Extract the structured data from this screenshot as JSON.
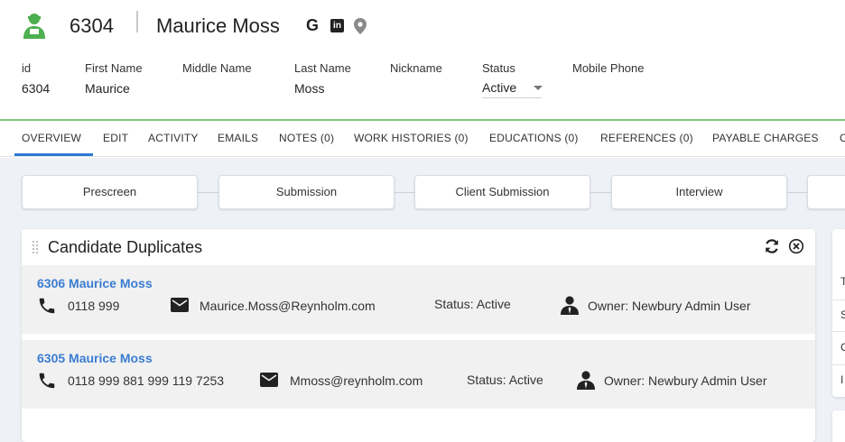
{
  "header": {
    "record_id": "6304",
    "name": "Maurice Moss",
    "google_label": "G",
    "linkedin_label": "in",
    "fields": [
      {
        "label": "id",
        "value": "6304"
      },
      {
        "label": "First Name",
        "value": "Maurice"
      },
      {
        "label": "Middle Name",
        "value": ""
      },
      {
        "label": "Last Name",
        "value": "Moss"
      },
      {
        "label": "Nickname",
        "value": ""
      },
      {
        "label": "Status",
        "value": "Active"
      },
      {
        "label": "Mobile Phone",
        "value": ""
      }
    ],
    "accent_color": "#4caf50"
  },
  "tabs": [
    {
      "label": "OVERVIEW",
      "active": true
    },
    {
      "label": "EDIT"
    },
    {
      "label": "ACTIVITY"
    },
    {
      "label": "EMAILS"
    },
    {
      "label": "NOTES (0)"
    },
    {
      "label": "WORK HISTORIES (0)"
    },
    {
      "label": "EDUCATIONS (0)"
    },
    {
      "label": "REFERENCES (0)"
    },
    {
      "label": "PAYABLE CHARGES"
    },
    {
      "label": "C"
    }
  ],
  "pipeline": [
    {
      "label": "Prescreen"
    },
    {
      "label": "Submission"
    },
    {
      "label": "Client Submission"
    },
    {
      "label": "Interview"
    }
  ],
  "duplicates_card": {
    "title": "Candidate Duplicates",
    "rows": [
      {
        "name": "6306 Maurice Moss",
        "phone": "0118 999",
        "email": "Maurice.Moss@Reynholm.com",
        "status": "Status: Active",
        "owner": "Owner: Newbury Admin User"
      },
      {
        "name": "6305 Maurice Moss",
        "phone": "0118 999 881 999 119 7253",
        "email": "Mmoss@reynholm.com",
        "status": "Status: Active",
        "owner": "Owner: Newbury Admin User"
      }
    ]
  },
  "right_panel_letters": [
    "T",
    "S",
    "C",
    "I"
  ],
  "colors": {
    "link": "#3a7dd1",
    "tab_underline": "#2b7bd3",
    "green_line": "#5cb85c",
    "background": "#eef2f7"
  }
}
